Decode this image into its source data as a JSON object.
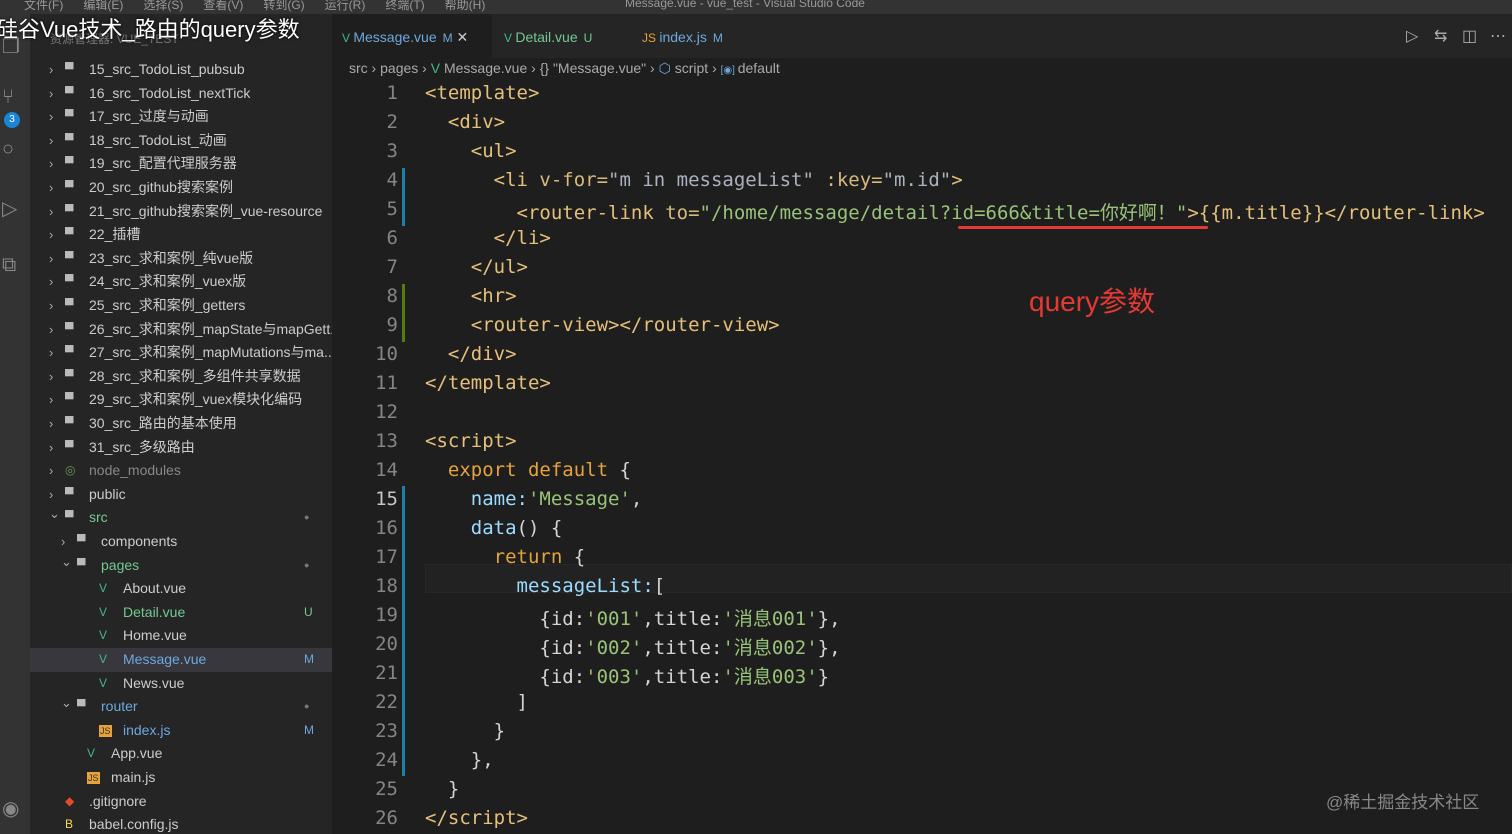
{
  "window": {
    "menu": [
      "文件(F)",
      "编辑(E)",
      "选择(S)",
      "查看(V)",
      "转到(G)",
      "运行(R)",
      "终端(T)",
      "帮助(H)"
    ],
    "title": "Message.vue - vue_test - Visual Studio Code"
  },
  "overlay_title": "硅谷Vue技术_路由的query参数",
  "activity": {
    "scm_badge": "3"
  },
  "sidebar": {
    "header": "资源管理器: VUE_TEST",
    "items": [
      {
        "label": "15_src_TodoList_pubsub",
        "depth": 0,
        "type": "folder"
      },
      {
        "label": "16_src_TodoList_nextTick",
        "depth": 0,
        "type": "folder"
      },
      {
        "label": "17_src_过度与动画",
        "depth": 0,
        "type": "folder"
      },
      {
        "label": "18_src_TodoList_动画",
        "depth": 0,
        "type": "folder"
      },
      {
        "label": "19_src_配置代理服务器",
        "depth": 0,
        "type": "folder"
      },
      {
        "label": "20_src_github搜索案例",
        "depth": 0,
        "type": "folder"
      },
      {
        "label": "21_src_github搜索案例_vue-resource",
        "depth": 0,
        "type": "folder"
      },
      {
        "label": "22_插槽",
        "depth": 0,
        "type": "folder"
      },
      {
        "label": "23_src_求和案例_纯vue版",
        "depth": 0,
        "type": "folder"
      },
      {
        "label": "24_src_求和案例_vuex版",
        "depth": 0,
        "type": "folder"
      },
      {
        "label": "25_src_求和案例_getters",
        "depth": 0,
        "type": "folder"
      },
      {
        "label": "26_src_求和案例_mapState与mapGett...",
        "depth": 0,
        "type": "folder"
      },
      {
        "label": "27_src_求和案例_mapMutations与ma...",
        "depth": 0,
        "type": "folder"
      },
      {
        "label": "28_src_求和案例_多组件共享数据",
        "depth": 0,
        "type": "folder"
      },
      {
        "label": "29_src_求和案例_vuex模块化编码",
        "depth": 0,
        "type": "folder"
      },
      {
        "label": "30_src_路由的基本使用",
        "depth": 0,
        "type": "folder"
      },
      {
        "label": "31_src_多级路由",
        "depth": 0,
        "type": "folder"
      },
      {
        "label": "node_modules",
        "depth": 0,
        "type": "node",
        "dim": true
      },
      {
        "label": "public",
        "depth": 0,
        "type": "folder"
      },
      {
        "label": "src",
        "depth": 0,
        "type": "open",
        "color": "#73c991",
        "status": "●"
      },
      {
        "label": "components",
        "depth": 1,
        "type": "folder"
      },
      {
        "label": "pages",
        "depth": 1,
        "type": "open",
        "color": "#73c991",
        "status": "●"
      },
      {
        "label": "About.vue",
        "depth": 2,
        "type": "vue"
      },
      {
        "label": "Detail.vue",
        "depth": 2,
        "type": "vue",
        "color": "#73c991",
        "status": "U"
      },
      {
        "label": "Home.vue",
        "depth": 2,
        "type": "vue"
      },
      {
        "label": "Message.vue",
        "depth": 2,
        "type": "vue",
        "color": "#6fa8dc",
        "status": "M",
        "selected": true
      },
      {
        "label": "News.vue",
        "depth": 2,
        "type": "vue"
      },
      {
        "label": "router",
        "depth": 1,
        "type": "open",
        "color": "#6fa8dc",
        "status": "●"
      },
      {
        "label": "index.js",
        "depth": 2,
        "type": "js",
        "color": "#6fa8dc",
        "status": "M"
      },
      {
        "label": "App.vue",
        "depth": 1,
        "type": "vue"
      },
      {
        "label": "main.js",
        "depth": 1,
        "type": "js"
      },
      {
        "label": ".gitignore",
        "depth": 0,
        "type": "git"
      },
      {
        "label": "babel.config.js",
        "depth": 0,
        "type": "babel"
      }
    ]
  },
  "tabs": [
    {
      "label": "Message.vue",
      "status": "M",
      "active": true,
      "color": "#6fa8dc"
    },
    {
      "label": "Detail.vue",
      "status": "U",
      "color": "#73c991"
    },
    {
      "label": "index.js",
      "status": "M",
      "color": "#6fa8dc"
    }
  ],
  "breadcrumb": [
    "src",
    "pages",
    "Message.vue",
    "{} \"Message.vue\"",
    "script",
    "default"
  ],
  "editor": {
    "current_line": 15,
    "lines": [
      [
        [
          "<template>",
          "t-tag"
        ]
      ],
      [
        [
          "  <div>",
          "t-tag"
        ]
      ],
      [
        [
          "    <ul>",
          "t-tag"
        ]
      ],
      [
        [
          "      <li ",
          "t-tag"
        ],
        [
          "v-for=",
          "t-attr"
        ],
        [
          "\"m in messageList\"",
          "t-c"
        ],
        [
          " :key=",
          "t-attr"
        ],
        [
          "\"m.id\"",
          "t-c"
        ],
        [
          ">",
          "t-tag"
        ]
      ],
      [
        [
          "        <router-link ",
          "t-tag"
        ],
        [
          "to=",
          "t-attr"
        ],
        [
          "\"/home/message/detail?id=666&title=你好啊！\"",
          "t-str"
        ],
        [
          ">{{m.title}}</router-link>",
          "t-tag"
        ]
      ],
      [
        [
          "      </li>",
          "t-tag"
        ]
      ],
      [
        [
          "    </ul>",
          "t-tag"
        ]
      ],
      [
        [
          "    <hr>",
          "t-tag"
        ]
      ],
      [
        [
          "    <router-view></router-view>",
          "t-tag"
        ]
      ],
      [
        [
          "  </div>",
          "t-tag"
        ]
      ],
      [
        [
          "</template>",
          "t-tag"
        ]
      ],
      [
        [
          "",
          ""
        ]
      ],
      [
        [
          "<script>",
          "t-tag"
        ]
      ],
      [
        [
          "  export default ",
          "t-kw"
        ],
        [
          "{",
          "t-p"
        ]
      ],
      [
        [
          "    name:",
          "t-prop"
        ],
        [
          "'Message'",
          "t-str"
        ],
        [
          ",",
          "t-p"
        ]
      ],
      [
        [
          "    data",
          "t-fn"
        ],
        [
          "() {",
          "t-p"
        ]
      ],
      [
        [
          "      return ",
          "t-kw"
        ],
        [
          "{",
          "t-p"
        ]
      ],
      [
        [
          "        messageList:",
          "t-prop"
        ],
        [
          "[",
          "t-p"
        ]
      ],
      [
        [
          "          {id:",
          "t-p"
        ],
        [
          "'001'",
          "t-str"
        ],
        [
          ",title:",
          "t-p"
        ],
        [
          "'消息001'",
          "t-str"
        ],
        [
          "},",
          "t-p"
        ]
      ],
      [
        [
          "          {id:",
          "t-p"
        ],
        [
          "'002'",
          "t-str"
        ],
        [
          ",title:",
          "t-p"
        ],
        [
          "'消息002'",
          "t-str"
        ],
        [
          "},",
          "t-p"
        ]
      ],
      [
        [
          "          {id:",
          "t-p"
        ],
        [
          "'003'",
          "t-str"
        ],
        [
          ",title:",
          "t-p"
        ],
        [
          "'消息003'",
          "t-str"
        ],
        [
          "}",
          "t-p"
        ]
      ],
      [
        [
          "        ]",
          "t-p"
        ]
      ],
      [
        [
          "      }",
          "t-p"
        ]
      ],
      [
        [
          "    },",
          "t-p"
        ]
      ],
      [
        [
          "  }",
          "t-p"
        ]
      ],
      [
        [
          "</script>",
          "t-tag"
        ]
      ]
    ]
  },
  "annotation": "query参数",
  "watermark": "@稀土掘金技术社区"
}
